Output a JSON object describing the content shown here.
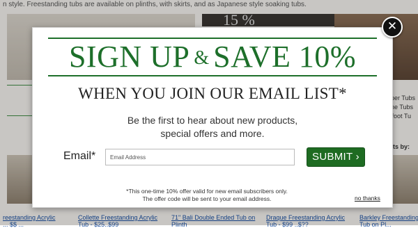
{
  "background_page": {
    "top_text": "n style. Freestanding tubs are available on plinths, with skirts, and as Japanese style soaking tubs.",
    "banner_fragment": "15 %",
    "side_links": [
      "oper Tubs",
      "ane Tubs",
      "wfoot Tu"
    ],
    "side_heading": "ults by:",
    "product_captions": [
      {
        "title": "reestanding Acrylic",
        "sub": "... $$ ..."
      },
      {
        "title": "Collette Freestanding Acrylic",
        "sub": "Tub - $25..$99"
      },
      {
        "title": "71\" Bali Double Ended Tub on",
        "sub": "Plinth"
      },
      {
        "title": "Draque Freestanding Acrylic",
        "sub": "Tub - $99 ..$??"
      },
      {
        "title": "Barkley Freestanding Acrylic",
        "sub": "Tub on Pl..."
      }
    ]
  },
  "modal": {
    "close_symbol": "✕",
    "headline_left": "SIGN UP",
    "headline_amp": "&",
    "headline_right": "SAVE 10%",
    "subheadline": "WHEN YOU JOIN OUR EMAIL LIST*",
    "blurb_line1": "Be the first to hear about new products,",
    "blurb_line2": "special offers and more.",
    "email_label": "Email*",
    "email_placeholder": "Email Address",
    "email_value": "",
    "submit_label": "SUBMIT ›",
    "fineprint_line1": "*This one-time 10% offer valid for new email subscribers only.",
    "fineprint_line2": "The offer code will be sent to your email address.",
    "no_thanks_label": "no thanks"
  },
  "colors": {
    "brand_green": "#1d6f2a",
    "submit_green": "#1e6b22",
    "close_bg": "#111111"
  }
}
